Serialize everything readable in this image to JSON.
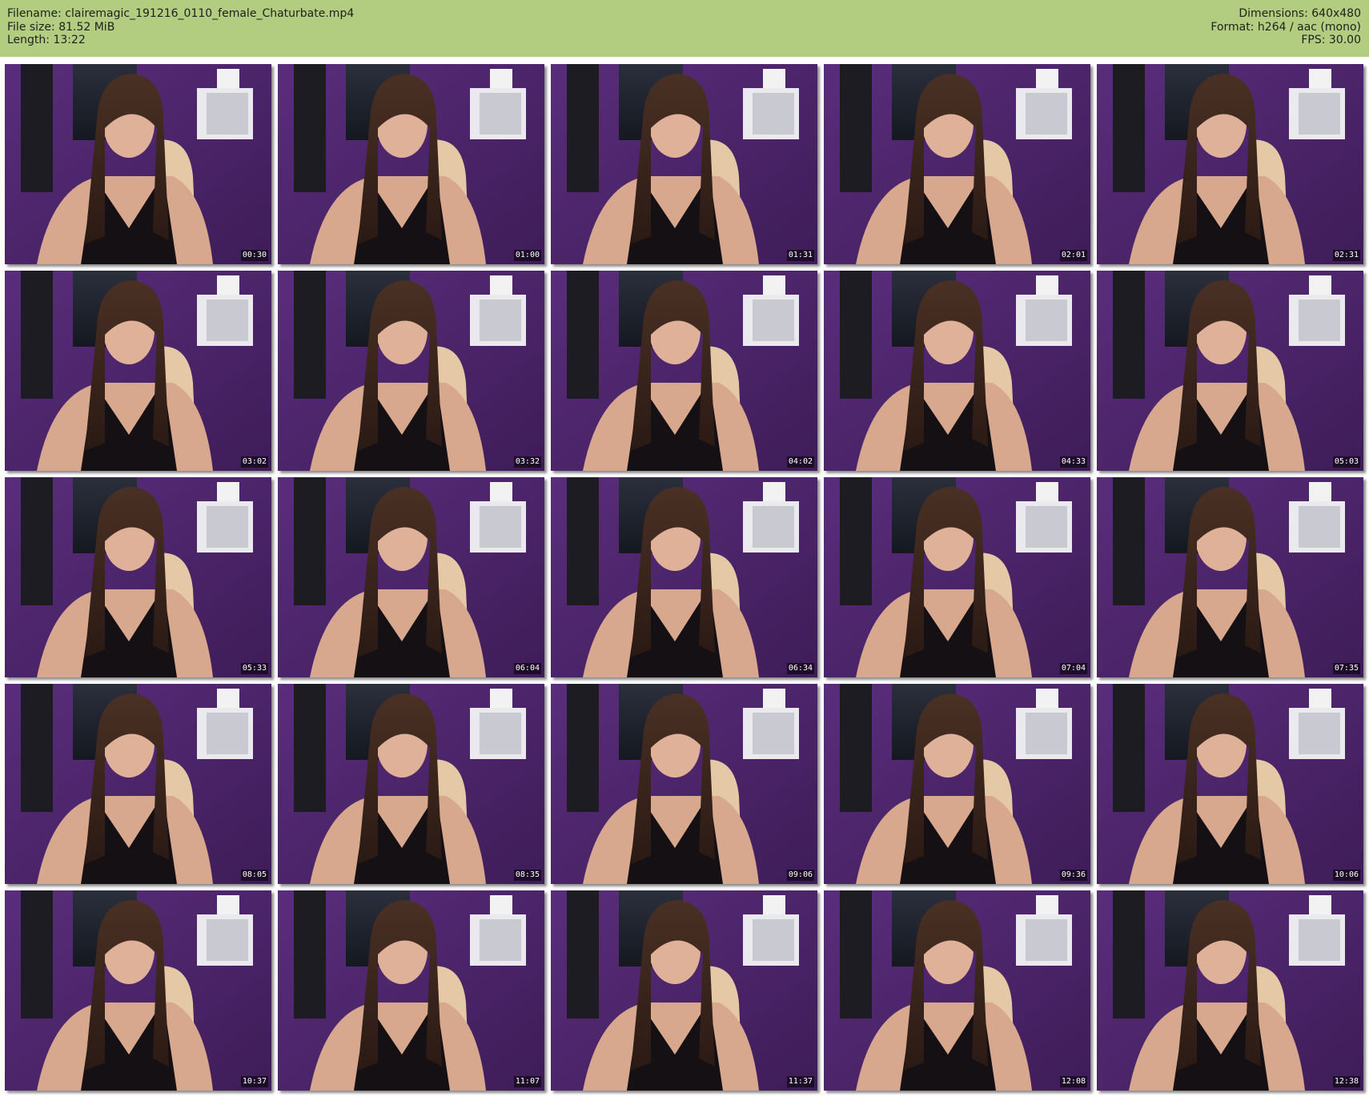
{
  "header": {
    "filename_line": "Filename: clairemagic_191216_0110_female_Chaturbate.mp4",
    "filesize_line": "File size: 81.52 MiB",
    "length_line": "Length: 13:22",
    "dimensions_line": "Dimensions: 640x480",
    "format_line": "Format: h264 / aac (mono)",
    "fps_line": "FPS: 30.00",
    "background_color": "#b2cd80"
  },
  "thumbnails": [
    "00:30",
    "01:00",
    "01:31",
    "02:01",
    "02:31",
    "03:02",
    "03:32",
    "04:02",
    "04:33",
    "05:03",
    "05:33",
    "06:04",
    "06:34",
    "07:04",
    "07:35",
    "08:05",
    "08:35",
    "09:06",
    "09:36",
    "10:06",
    "10:37",
    "11:07",
    "11:37",
    "12:08",
    "12:38"
  ]
}
